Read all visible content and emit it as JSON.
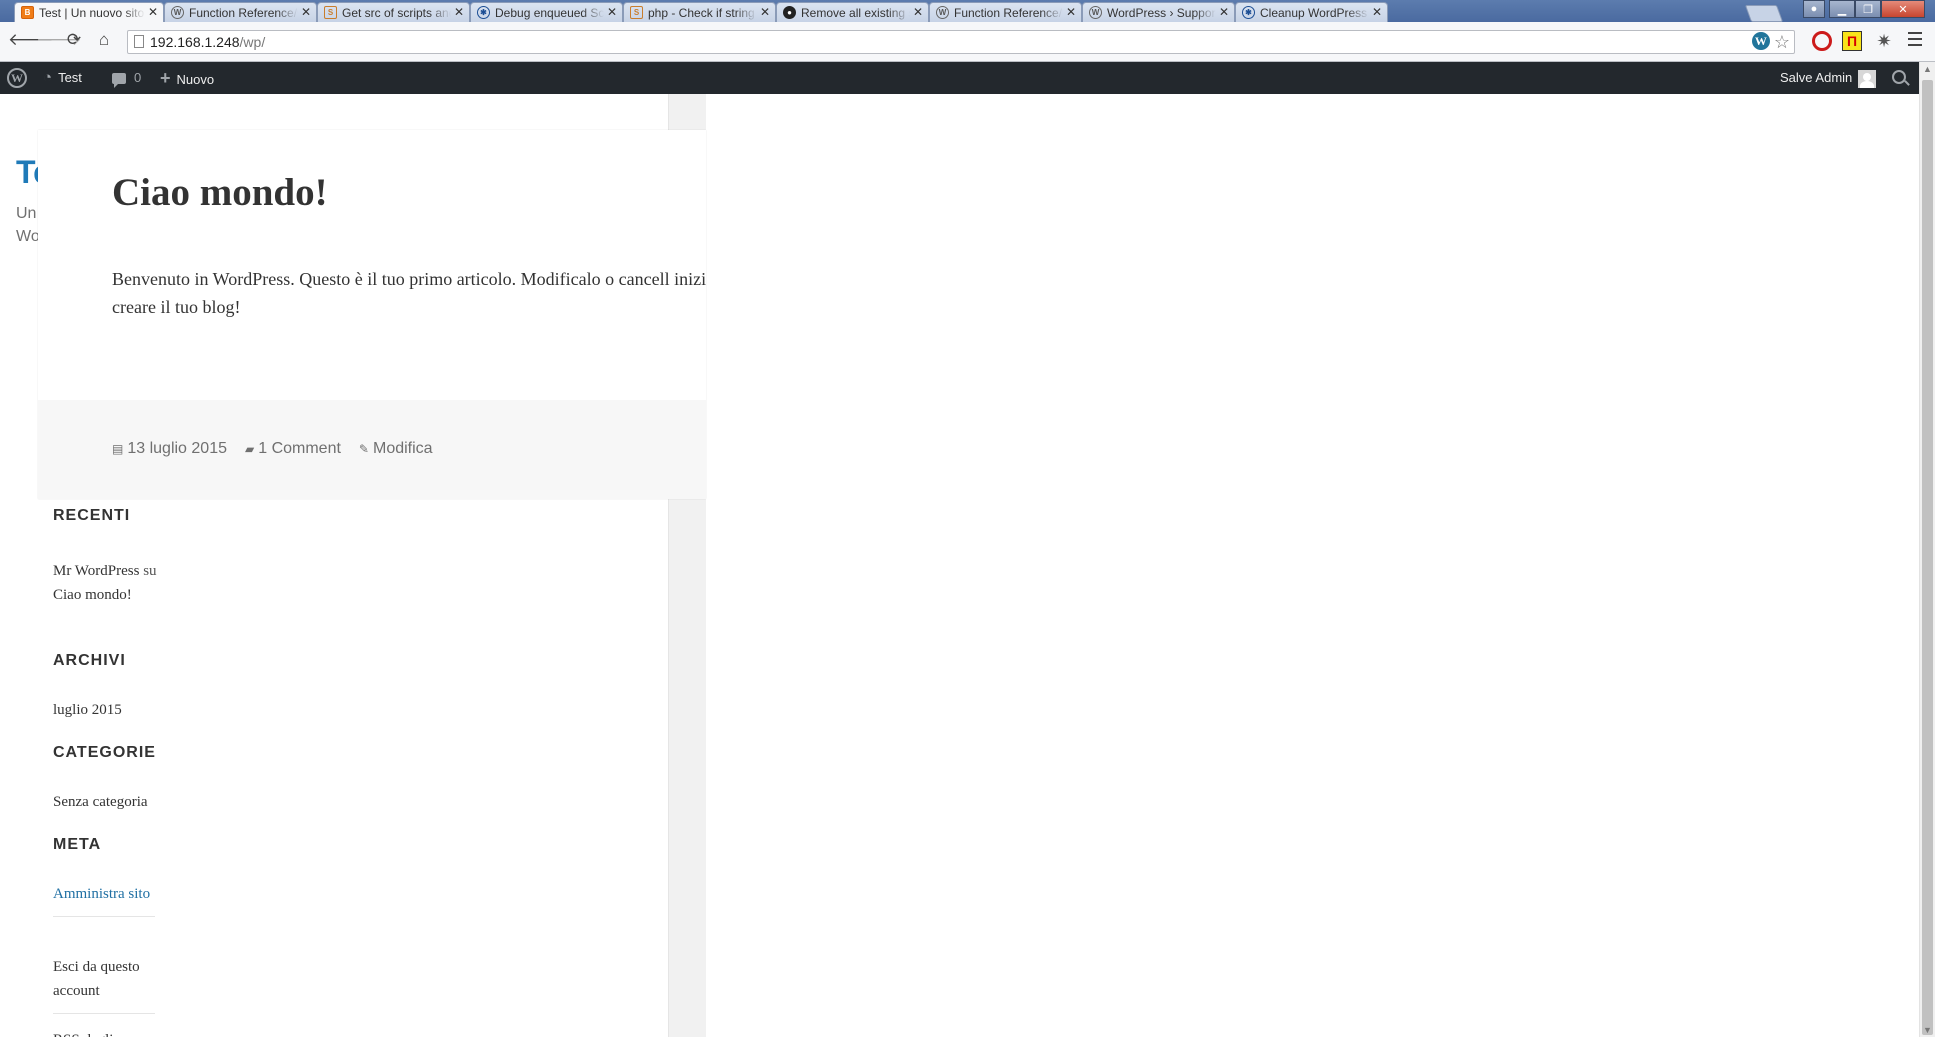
{
  "browser": {
    "tabs": [
      {
        "title": "Test | Un nuovo sito targa",
        "icon": "blogger-icon"
      },
      {
        "title": "Function Reference/wp fo",
        "icon": "wordpress-icon"
      },
      {
        "title": "Get src of scripts and style",
        "icon": "stackoverflow-icon"
      },
      {
        "title": "Debug enqueued Scripts",
        "icon": "gear-icon"
      },
      {
        "title": "php - Check if string cont",
        "icon": "stackoverflow-icon"
      },
      {
        "title": "Remove all existing script",
        "icon": "github-icon"
      },
      {
        "title": "Function Reference/wp de",
        "icon": "wordpress-icon"
      },
      {
        "title": "WordPress › Support » Re",
        "icon": "wordpress-icon"
      },
      {
        "title": "Cleanup WordPress Head",
        "icon": "gear-icon"
      }
    ],
    "close_glyph": "✕",
    "url_host": "192.168.1.248",
    "url_path": "/wp/"
  },
  "adminbar": {
    "site_name": "Test",
    "comments_count": "0",
    "new_label": "Nuovo",
    "greeting": "Salve Admin"
  },
  "site": {
    "title_fragment": "Te",
    "desc_line1": "Un",
    "desc_line2": "Wo"
  },
  "post": {
    "title": "Ciao mondo!",
    "content": "Benvenuto in WordPress. Questo è il tuo primo articolo. Modificalo o cancell inizia a creare il tuo blog!",
    "date": "13 luglio 2015",
    "comments": "1 Comment",
    "edit": "Modifica"
  },
  "sidebar": {
    "recent_comments_title": "COMMENTI RECENTI",
    "recent_comment_author": "Mr WordPress",
    "recent_comment_on": "su",
    "recent_comment_post": "Ciao mondo!",
    "archives_title": "ARCHIVI",
    "archive_item": "luglio 2015",
    "categories_title": "CATEGORIE",
    "category_item": "Senza categoria",
    "meta_title": "META",
    "meta_items": [
      "Amministra sito",
      "Esci da questo account",
      "RSS degli"
    ]
  }
}
